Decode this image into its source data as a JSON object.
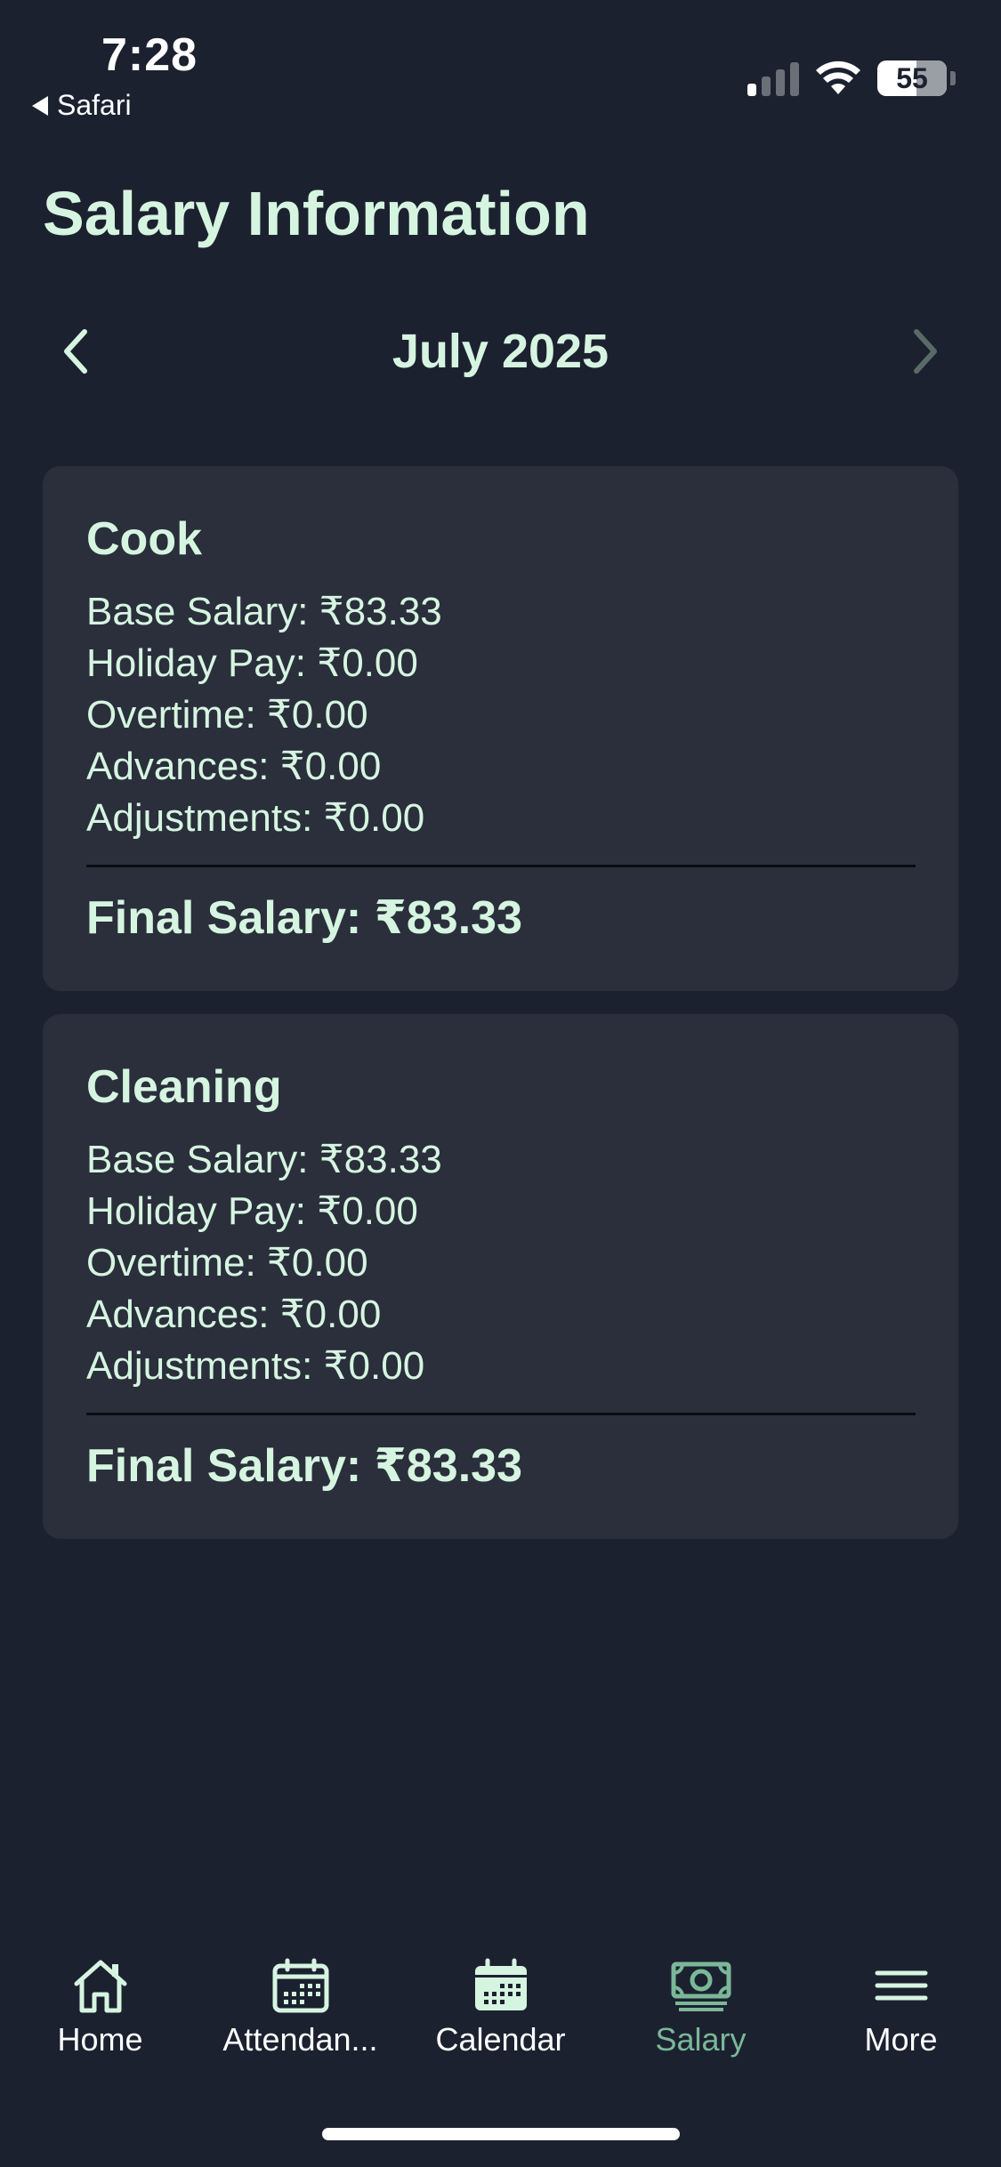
{
  "status_bar": {
    "time": "7:28",
    "back_app": "Safari",
    "battery": "55"
  },
  "page": {
    "title": "Salary Information"
  },
  "month_nav": {
    "label": "July 2025"
  },
  "cards": [
    {
      "title": "Cook",
      "lines": [
        "Base Salary: ₹83.33",
        "Holiday Pay: ₹0.00",
        "Overtime: ₹0.00",
        "Advances: ₹0.00",
        "Adjustments: ₹0.00"
      ],
      "final": "Final Salary: ₹83.33"
    },
    {
      "title": "Cleaning",
      "lines": [
        "Base Salary: ₹83.33",
        "Holiday Pay: ₹0.00",
        "Overtime: ₹0.00",
        "Advances: ₹0.00",
        "Adjustments: ₹0.00"
      ],
      "final": "Final Salary: ₹83.33"
    }
  ],
  "tabs": [
    {
      "label": "Home",
      "icon": "home-icon"
    },
    {
      "label": "Attendan...",
      "icon": "attendance-calendar-icon"
    },
    {
      "label": "Calendar",
      "icon": "calendar-icon"
    },
    {
      "label": "Salary",
      "icon": "money-icon",
      "active": true
    },
    {
      "label": "More",
      "icon": "menu-icon"
    }
  ],
  "colors": {
    "background": "#1c2130",
    "card": "#2a2f3b",
    "text": "#d6f5e1",
    "active_tab": "#7ab898"
  }
}
